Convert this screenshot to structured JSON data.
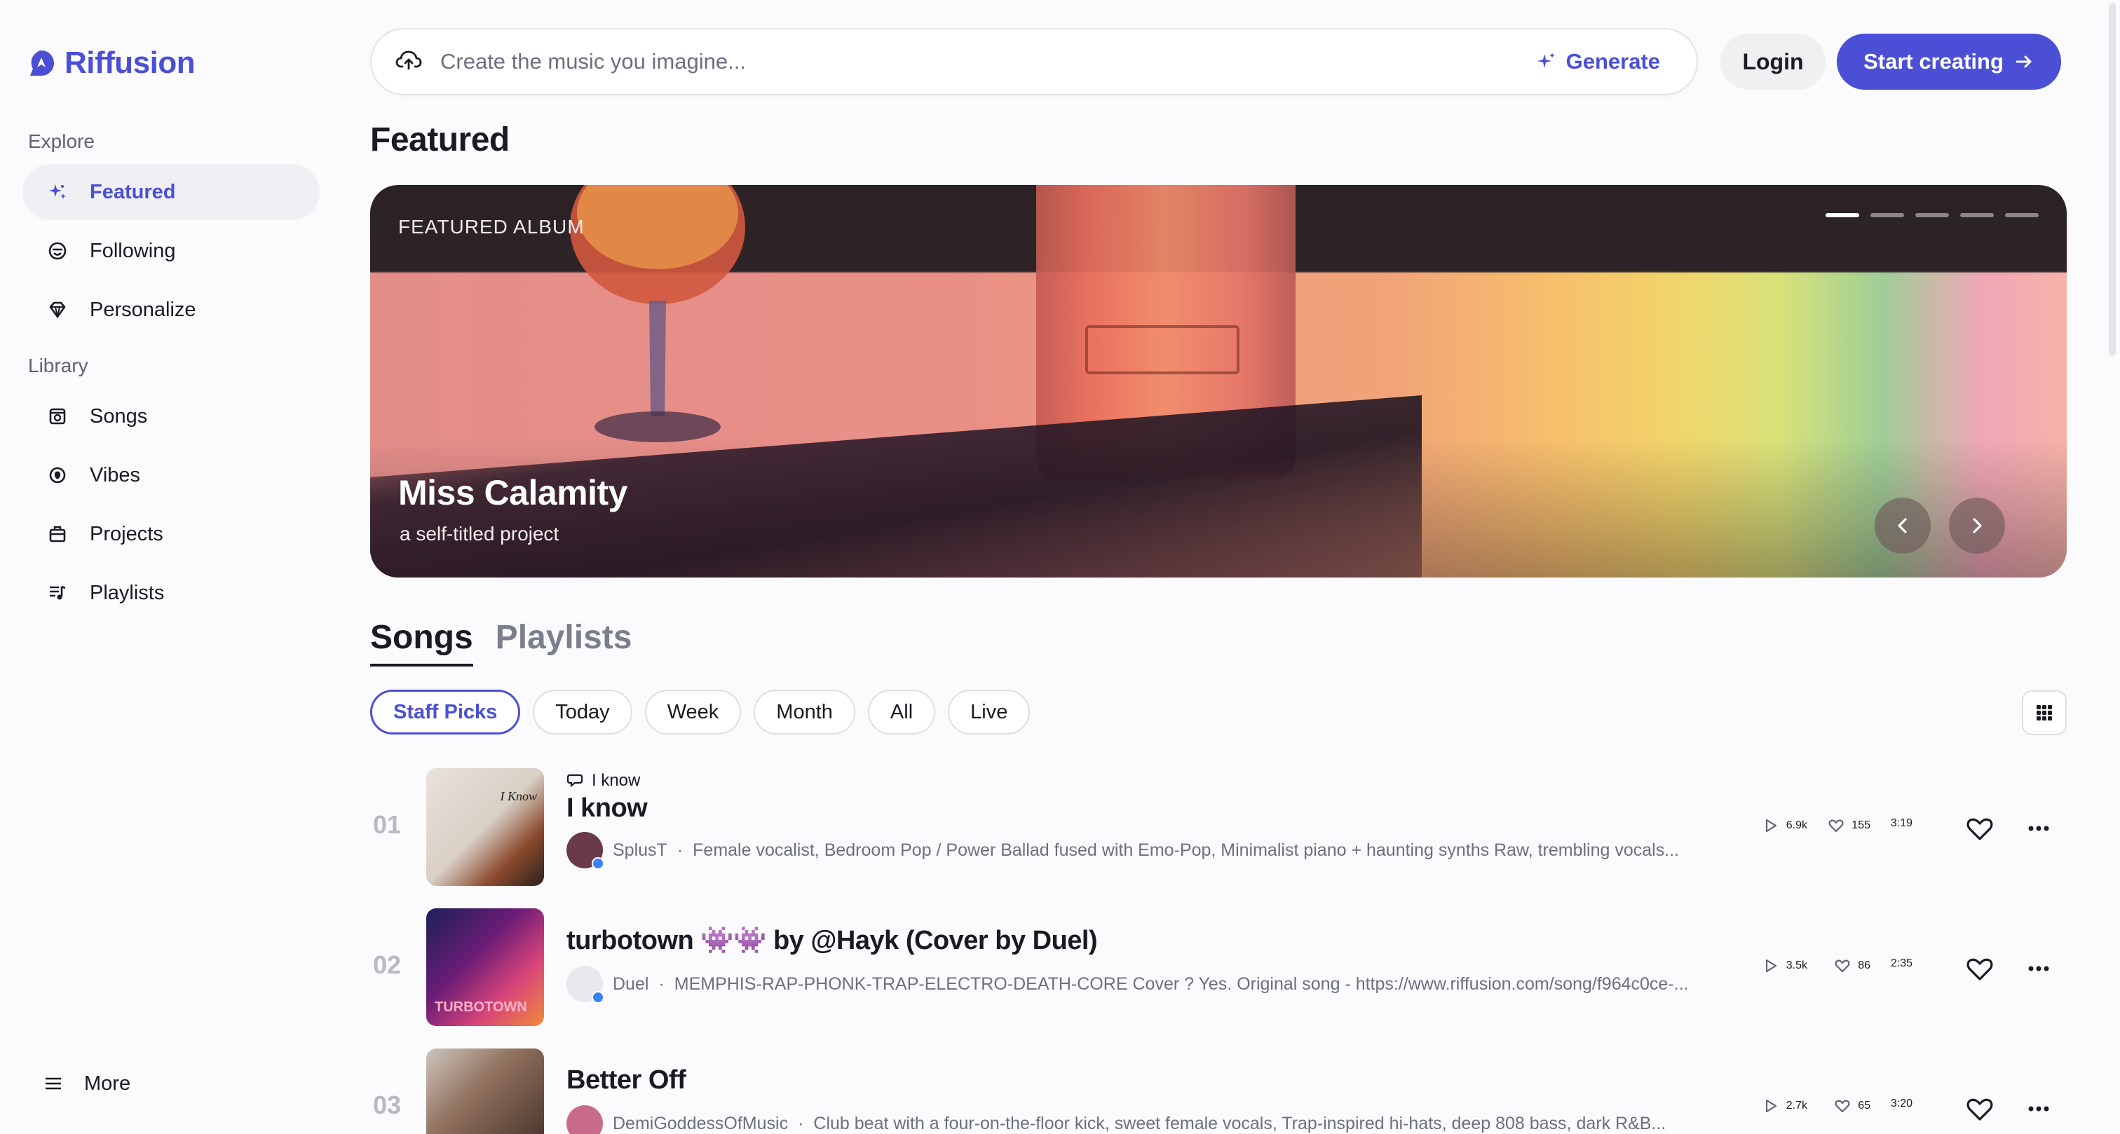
{
  "brand": {
    "name": "Riffusion",
    "accent": "#4b4fd6"
  },
  "sidebar": {
    "explore_label": "Explore",
    "library_label": "Library",
    "explore_items": [
      {
        "label": "Featured",
        "icon": "sparkle-icon",
        "active": true
      },
      {
        "label": "Following",
        "icon": "smile-face-icon",
        "active": false
      },
      {
        "label": "Personalize",
        "icon": "diamond-icon",
        "active": false
      }
    ],
    "library_items": [
      {
        "label": "Songs",
        "icon": "song-box-icon"
      },
      {
        "label": "Vibes",
        "icon": "vibes-icon"
      },
      {
        "label": "Projects",
        "icon": "projects-icon"
      },
      {
        "label": "Playlists",
        "icon": "playlist-icon"
      }
    ],
    "more_label": "More"
  },
  "search": {
    "placeholder": "Create the music you imagine...",
    "generate_label": "Generate"
  },
  "header": {
    "login_label": "Login",
    "start_label": "Start creating"
  },
  "main": {
    "title": "Featured"
  },
  "hero": {
    "tag": "FEATURED ALBUM",
    "title": "Miss Calamity",
    "subtitle": "a self-titled project",
    "slides": 5,
    "active_slide": 1
  },
  "tabs": [
    {
      "label": "Songs",
      "active": true
    },
    {
      "label": "Playlists",
      "active": false
    }
  ],
  "filters": [
    {
      "label": "Staff Picks",
      "active": true
    },
    {
      "label": "Today",
      "active": false
    },
    {
      "label": "Week",
      "active": false
    },
    {
      "label": "Month",
      "active": false
    },
    {
      "label": "All",
      "active": false
    },
    {
      "label": "Live",
      "active": false
    }
  ],
  "songs": [
    {
      "number": "01",
      "cover_text": "I Know",
      "context": "I know",
      "title": "I know",
      "artist": "SplusT",
      "description": "Female vocalist, Bedroom Pop / Power Ballad fused with Emo-Pop, Minimalist piano + haunting synths Raw, trembling vocals...",
      "plays": "6.9k",
      "likes": "155",
      "duration": "3:19"
    },
    {
      "number": "02",
      "cover_text": "TURBOTOWN",
      "context": "",
      "title": "turbotown 👾👾 by @Hayk (Cover by Duel)",
      "artist": "Duel",
      "description": "MEMPHIS-RAP-PHONK-TRAP-ELECTRO-DEATH-CORE Cover ? Yes. Original song - https://www.riffusion.com/song/f964c0ce-...",
      "plays": "3.5k",
      "likes": "86",
      "duration": "2:35"
    },
    {
      "number": "03",
      "cover_text": "",
      "context": "",
      "title": "Better Off",
      "artist": "DemiGoddessOfMusic",
      "description": "Club beat with a four-on-the-floor kick, sweet female vocals, Trap-inspired hi-hats, deep 808 bass, dark R&B...",
      "plays": "2.7k",
      "likes": "65",
      "duration": "3:20"
    }
  ]
}
